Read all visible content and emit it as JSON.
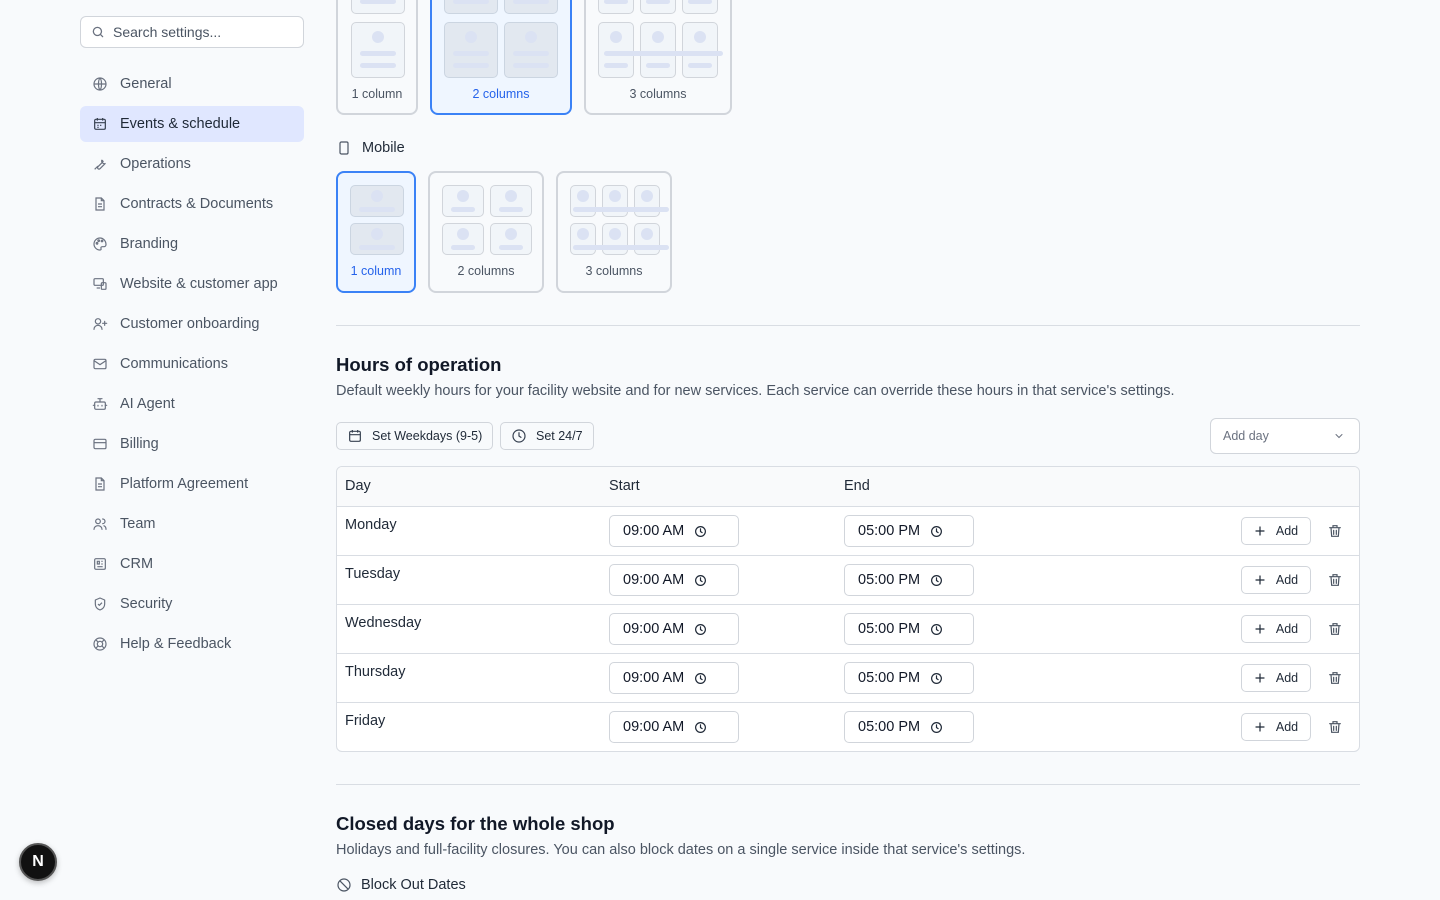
{
  "search": {
    "placeholder": "Search settings..."
  },
  "sidebar": {
    "items": [
      {
        "label": "General",
        "icon": "globe-icon"
      },
      {
        "label": "Events & schedule",
        "icon": "calendar-icon",
        "active": true
      },
      {
        "label": "Operations",
        "icon": "wrench-icon"
      },
      {
        "label": "Contracts & Documents",
        "icon": "document-icon"
      },
      {
        "label": "Branding",
        "icon": "palette-icon"
      },
      {
        "label": "Website & customer app",
        "icon": "devices-icon"
      },
      {
        "label": "Customer onboarding",
        "icon": "user-plus-icon"
      },
      {
        "label": "Communications",
        "icon": "mail-icon"
      },
      {
        "label": "AI Agent",
        "icon": "bot-icon"
      },
      {
        "label": "Billing",
        "icon": "credit-card-icon"
      },
      {
        "label": "Platform Agreement",
        "icon": "document-icon"
      },
      {
        "label": "Team",
        "icon": "users-icon"
      },
      {
        "label": "CRM",
        "icon": "crm-icon"
      },
      {
        "label": "Security",
        "icon": "shield-icon"
      },
      {
        "label": "Help & Feedback",
        "icon": "lifebuoy-icon"
      }
    ]
  },
  "layout": {
    "desktop": {
      "options": [
        {
          "label": "1 column"
        },
        {
          "label": "2 columns",
          "selected": true
        },
        {
          "label": "3 columns"
        }
      ]
    },
    "mobile": {
      "label": "Mobile",
      "options": [
        {
          "label": "1 column",
          "selected": true
        },
        {
          "label": "2 columns"
        },
        {
          "label": "3 columns"
        }
      ]
    }
  },
  "hours": {
    "title": "Hours of operation",
    "description": "Default weekly hours for your facility website and for new services. Each service can override these hours in that service's settings.",
    "set_weekdays_label": "Set Weekdays (9-5)",
    "set_247_label": "Set 24/7",
    "add_day_placeholder": "Add day",
    "columns": {
      "day": "Day",
      "start": "Start",
      "end": "End"
    },
    "add_label": "Add",
    "rows": [
      {
        "day": "Monday",
        "start": "09:00 AM",
        "end": "05:00 PM"
      },
      {
        "day": "Tuesday",
        "start": "09:00 AM",
        "end": "05:00 PM"
      },
      {
        "day": "Wednesday",
        "start": "09:00 AM",
        "end": "05:00 PM"
      },
      {
        "day": "Thursday",
        "start": "09:00 AM",
        "end": "05:00 PM"
      },
      {
        "day": "Friday",
        "start": "09:00 AM",
        "end": "05:00 PM"
      }
    ]
  },
  "closed": {
    "title": "Closed days for the whole shop",
    "description": "Holidays and full-facility closures. You can also block dates on a single service inside that service's settings.",
    "block_out_label": "Block Out Dates"
  },
  "fab": {
    "letter": "N"
  },
  "colors": {
    "accent": "#3b82f6",
    "active_nav_bg": "#e0e7ff",
    "background": "#f8fafc"
  }
}
